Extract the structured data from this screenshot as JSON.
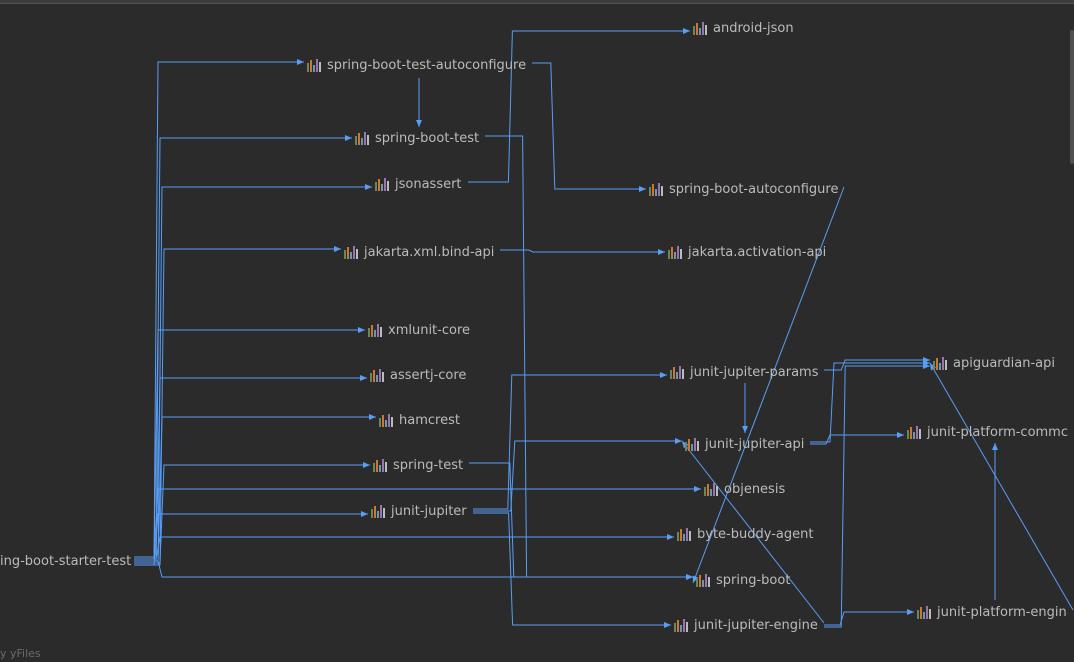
{
  "graph": {
    "nodes": [
      {
        "id": "starter-test",
        "label": "ing-boot-starter-test",
        "hasIcon": false
      },
      {
        "id": "test-autoconfigure",
        "label": "spring-boot-test-autoconfigure",
        "hasIcon": true
      },
      {
        "id": "boot-test",
        "label": "spring-boot-test",
        "hasIcon": true
      },
      {
        "id": "jsonassert",
        "label": "jsonassert",
        "hasIcon": true
      },
      {
        "id": "jakarta-xml",
        "label": "jakarta.xml.bind-api",
        "hasIcon": true
      },
      {
        "id": "xmlunit",
        "label": "xmlunit-core",
        "hasIcon": true
      },
      {
        "id": "assertj",
        "label": "assertj-core",
        "hasIcon": true
      },
      {
        "id": "hamcrest",
        "label": "hamcrest",
        "hasIcon": true
      },
      {
        "id": "spring-test",
        "label": "spring-test",
        "hasIcon": true
      },
      {
        "id": "junit-jupiter",
        "label": "junit-jupiter",
        "hasIcon": true
      },
      {
        "id": "android-json",
        "label": "android-json",
        "hasIcon": true
      },
      {
        "id": "boot-autoconfigure",
        "label": "spring-boot-autoconfigure",
        "hasIcon": true
      },
      {
        "id": "jakarta-activation",
        "label": "jakarta.activation-api",
        "hasIcon": true
      },
      {
        "id": "jupiter-params",
        "label": "junit-jupiter-params",
        "hasIcon": true
      },
      {
        "id": "jupiter-api",
        "label": "junit-jupiter-api",
        "hasIcon": true
      },
      {
        "id": "objenesis",
        "label": "objenesis",
        "hasIcon": true
      },
      {
        "id": "byte-buddy",
        "label": "byte-buddy-agent",
        "hasIcon": true
      },
      {
        "id": "spring-boot",
        "label": "spring-boot",
        "hasIcon": true
      },
      {
        "id": "jupiter-engine",
        "label": "junit-jupiter-engine",
        "hasIcon": true
      },
      {
        "id": "apiguardian",
        "label": "apiguardian-api",
        "hasIcon": true
      },
      {
        "id": "platform-commons",
        "label": "junit-platform-commc",
        "hasIcon": true
      },
      {
        "id": "platform-engine",
        "label": "junit-platform-engin",
        "hasIcon": true
      }
    ],
    "edges": [
      [
        "starter-test",
        "test-autoconfigure"
      ],
      [
        "starter-test",
        "boot-test"
      ],
      [
        "starter-test",
        "jsonassert"
      ],
      [
        "starter-test",
        "jakarta-xml"
      ],
      [
        "starter-test",
        "xmlunit"
      ],
      [
        "starter-test",
        "assertj"
      ],
      [
        "starter-test",
        "hamcrest"
      ],
      [
        "starter-test",
        "spring-test"
      ],
      [
        "starter-test",
        "junit-jupiter"
      ],
      [
        "test-autoconfigure",
        "boot-test"
      ],
      [
        "test-autoconfigure",
        "boot-autoconfigure"
      ],
      [
        "jsonassert",
        "android-json"
      ],
      [
        "boot-test",
        "spring-boot"
      ],
      [
        "jakarta-xml",
        "jakarta-activation"
      ],
      [
        "junit-jupiter",
        "jupiter-params"
      ],
      [
        "junit-jupiter",
        "jupiter-api"
      ],
      [
        "junit-jupiter",
        "jupiter-engine"
      ],
      [
        "jupiter-params",
        "jupiter-api"
      ],
      [
        "jupiter-params",
        "apiguardian"
      ],
      [
        "jupiter-api",
        "apiguardian"
      ],
      [
        "jupiter-api",
        "platform-commons"
      ],
      [
        "jupiter-engine",
        "jupiter-api"
      ],
      [
        "jupiter-engine",
        "platform-engine"
      ],
      [
        "jupiter-engine",
        "apiguardian"
      ],
      [
        "platform-engine",
        "platform-commons"
      ],
      [
        "platform-engine",
        "apiguardian"
      ],
      [
        "boot-autoconfigure",
        "spring-boot"
      ],
      [
        "spring-test",
        "spring-boot"
      ],
      [
        "starter-test",
        "objenesis"
      ],
      [
        "starter-test",
        "byte-buddy"
      ],
      [
        "starter-test",
        "spring-boot"
      ]
    ],
    "icon_colors": [
      "#6a8759",
      "#cc7832",
      "#6897bb",
      "#9876aa",
      "#bbbbbb"
    ],
    "edge_color": "#589df6"
  },
  "watermark": "y yFiles"
}
